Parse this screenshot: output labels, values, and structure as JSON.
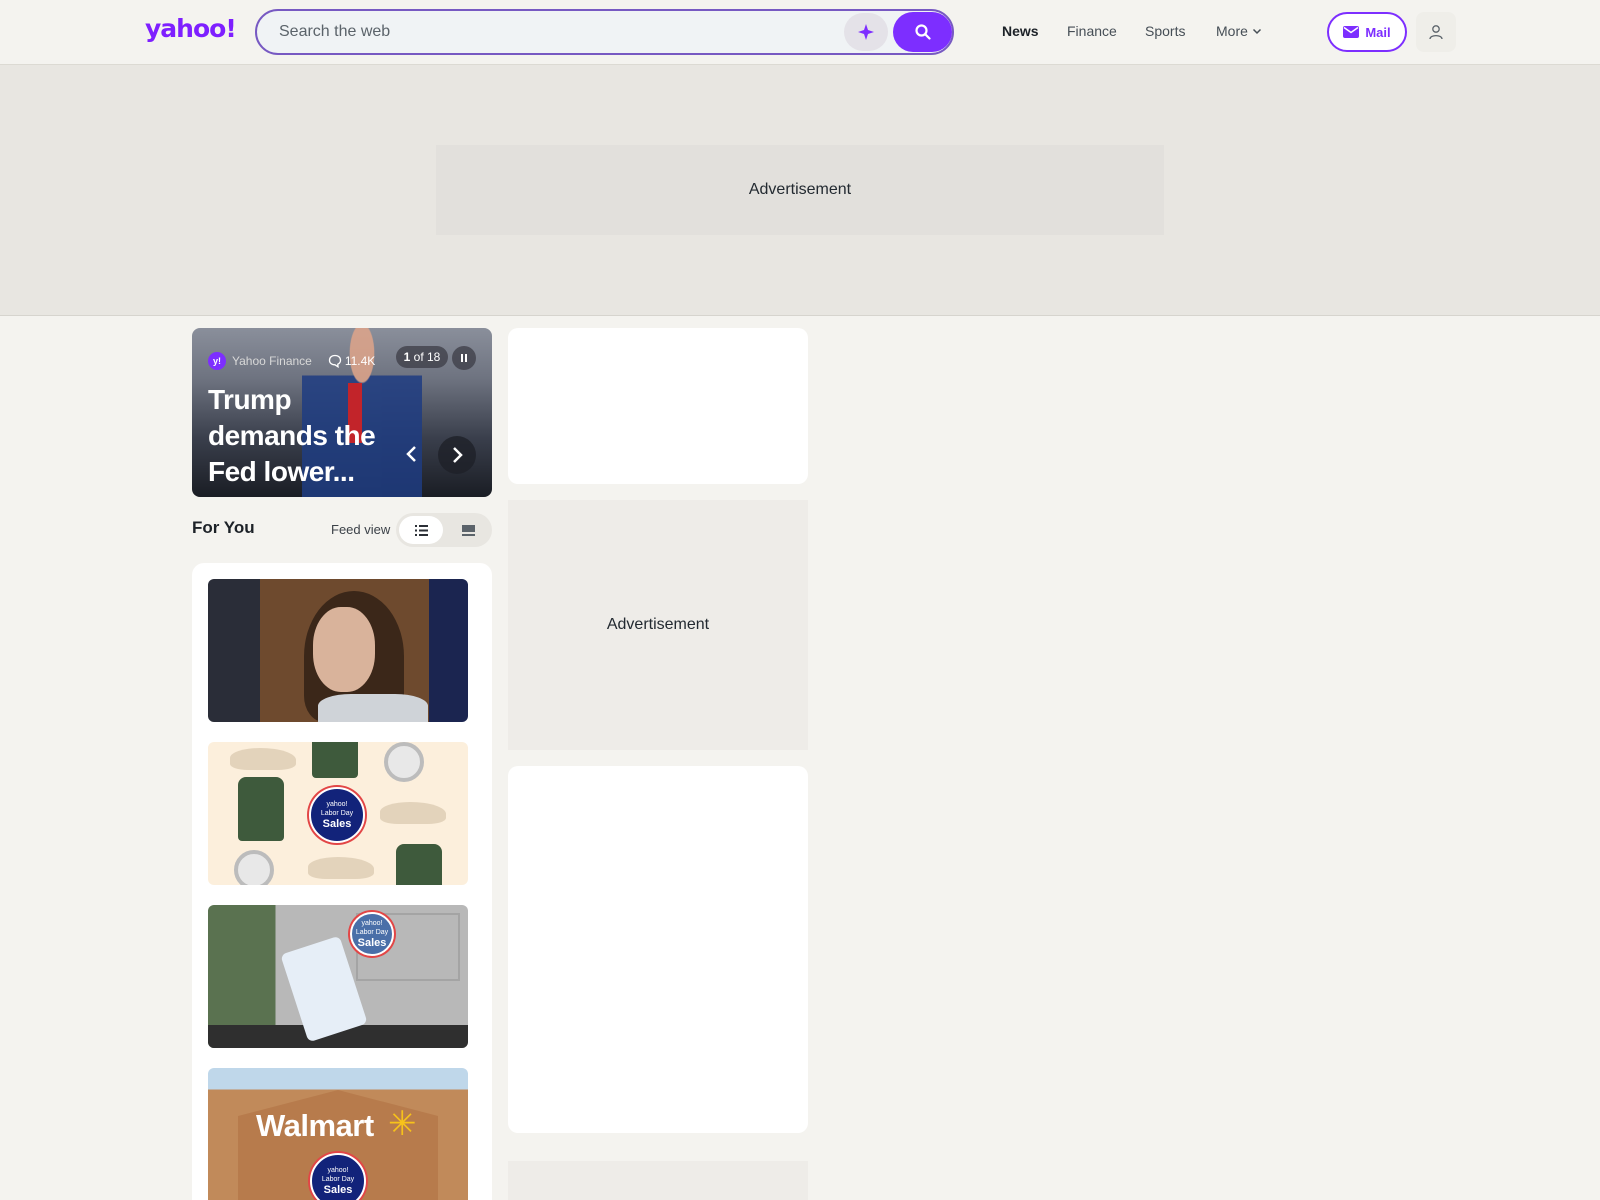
{
  "header": {
    "logo": "yahoo!",
    "search_placeholder": "Search the web",
    "nav": [
      "News",
      "Finance",
      "Sports",
      "More"
    ],
    "mail_label": "Mail"
  },
  "ads": {
    "top_label": "Advertisement",
    "side_label": "Advertisement"
  },
  "hero": {
    "source": "Yahoo Finance",
    "comments": "11.4K",
    "counter_current": "1",
    "counter_sep": "of 18",
    "title": "Trump demands the Fed lower..."
  },
  "feed": {
    "heading": "For You",
    "view_label": "Feed view",
    "badge_small_1": "yahoo!",
    "badge_small_2": "Labor Day",
    "badge_large": "Sales",
    "walmart_sign": "Walmart"
  },
  "colors": {
    "brand": "#7e1fff",
    "accent": "#7d2eff"
  }
}
